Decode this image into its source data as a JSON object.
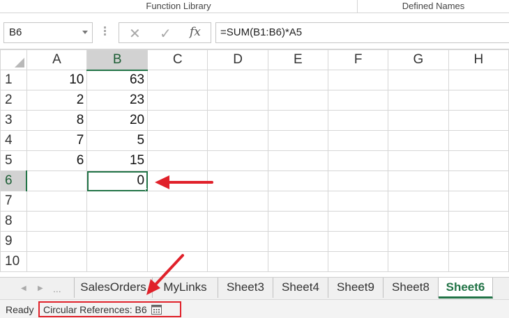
{
  "ribbon": {
    "groups": [
      "Function Library",
      "Defined Names"
    ]
  },
  "formula_bar": {
    "name_box": "B6",
    "cancel_icon": "x-icon",
    "enter_icon": "check-icon",
    "fx_label": "fx",
    "formula": "=SUM(B1:B6)*A5"
  },
  "sheet": {
    "columns": [
      "A",
      "B",
      "C",
      "D",
      "E",
      "F",
      "G",
      "H"
    ],
    "rows": [
      {
        "num": "1",
        "a": "10",
        "b": "63"
      },
      {
        "num": "2",
        "a": "2",
        "b": "23"
      },
      {
        "num": "3",
        "a": "8",
        "b": "20"
      },
      {
        "num": "4",
        "a": "7",
        "b": "5"
      },
      {
        "num": "5",
        "a": "6",
        "b": "15"
      },
      {
        "num": "6",
        "a": "",
        "b": "0"
      },
      {
        "num": "7",
        "a": "",
        "b": ""
      },
      {
        "num": "8",
        "a": "",
        "b": ""
      },
      {
        "num": "9",
        "a": "",
        "b": ""
      },
      {
        "num": "10",
        "a": "",
        "b": ""
      }
    ],
    "active_cell": "B6"
  },
  "tabs": {
    "ellipsis": "...",
    "items": [
      "SalesOrders",
      "MyLinks",
      "Sheet3",
      "Sheet4",
      "Sheet9",
      "Sheet8",
      "Sheet6"
    ],
    "active": "Sheet6"
  },
  "status": {
    "ready": "Ready",
    "circular": "Circular References: B6"
  },
  "colors": {
    "accent": "#217346",
    "annotation": "#e0212a"
  }
}
